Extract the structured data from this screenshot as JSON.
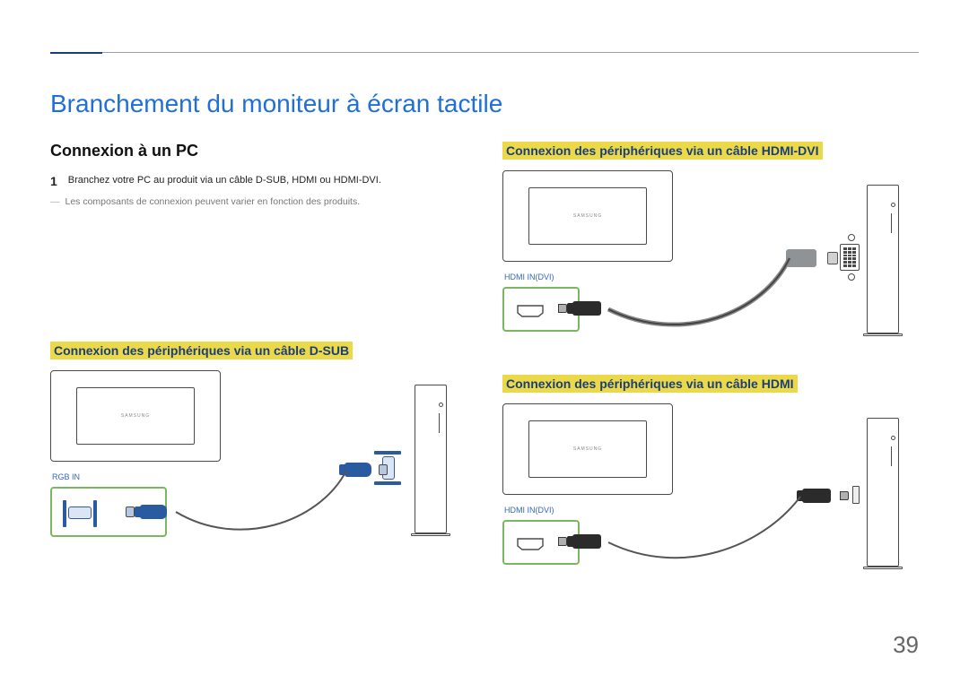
{
  "page_number": "39",
  "title": "Branchement du moniteur à écran tactile",
  "left": {
    "heading": "Connexion à un PC",
    "step_num": "1",
    "step_text": "Branchez votre PC au produit via un câble D-SUB, HDMI ou HDMI-DVI.",
    "note": "Les composants de connexion peuvent varier en fonction des produits.",
    "dsub": {
      "heading": "Connexion des périphériques via un câble D-SUB",
      "port_label": "RGB IN"
    }
  },
  "right": {
    "hdmi_dvi": {
      "heading": "Connexion des périphériques via un câble HDMI-DVI",
      "port_label": "HDMI IN(DVI)"
    },
    "hdmi": {
      "heading": "Connexion des périphériques via un câble HDMI",
      "port_label": "HDMI IN(DVI)"
    }
  },
  "brand": "SAMSUNG"
}
